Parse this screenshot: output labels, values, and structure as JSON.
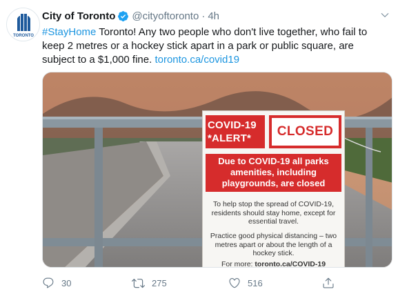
{
  "account": {
    "display_name": "City of Toronto",
    "handle": "@cityoftoronto",
    "separator": "·",
    "time": "4h",
    "avatar_text": "TORONTO"
  },
  "tweet": {
    "hashtag": "#StayHome",
    "body": " Toronto! Any two people who don't live together, who fail to keep 2 metres or a hockey stick apart in a park or public square, are subject to a $1,000 fine. ",
    "link": "toronto.ca/covid19"
  },
  "sign": {
    "alert_line1": "COVID-19",
    "alert_line2": "*ALERT*",
    "closed": "CLOSED",
    "banner": "Due to COVID-19 all parks amenities, including playgrounds, are closed",
    "para1": "To help stop the spread of COVID-19, residents should stay home, except for essential travel.",
    "para2": "Practice good physical distancing – two metres apart or about the length of a hockey stick.",
    "more_prefix": "For more: ",
    "more_link": "toronto.ca/COVID-19"
  },
  "actions": {
    "replies": "30",
    "retweets": "275",
    "likes": "516"
  },
  "colors": {
    "accent": "#1b95e0",
    "muted": "#657786",
    "verified": "#1da1f2",
    "sign_red": "#d62c2c",
    "logo_blue": "#1e5a9c"
  },
  "icons": [
    "verified-badge-icon",
    "chevron-down-icon",
    "reply-icon",
    "retweet-icon",
    "like-icon",
    "share-icon"
  ]
}
